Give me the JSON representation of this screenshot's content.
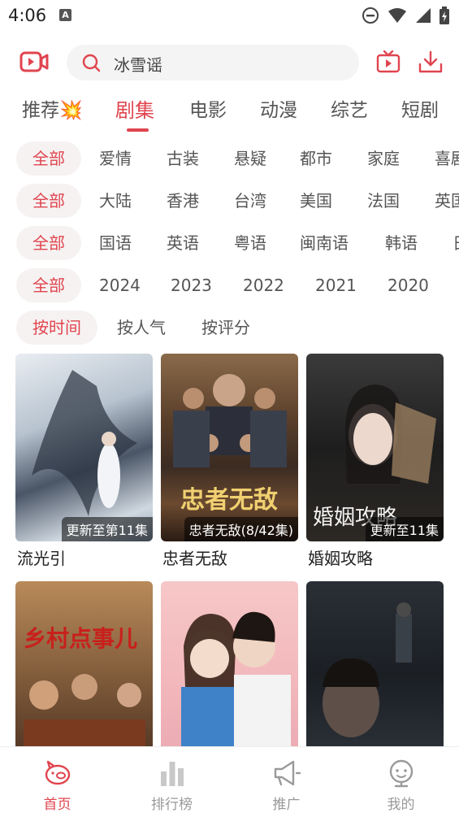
{
  "status_bar": {
    "time": "4:06",
    "a_icon_letter": "A"
  },
  "search": {
    "placeholder": "冰雪谣"
  },
  "tabs": [
    {
      "label": "推荐💥"
    },
    {
      "label": "剧集"
    },
    {
      "label": "电影"
    },
    {
      "label": "动漫"
    },
    {
      "label": "综艺"
    },
    {
      "label": "短剧"
    }
  ],
  "filters": {
    "genre": [
      "全部",
      "爱情",
      "古装",
      "悬疑",
      "都市",
      "家庭",
      "喜剧"
    ],
    "region": [
      "全部",
      "大陆",
      "香港",
      "台湾",
      "美国",
      "法国",
      "英国"
    ],
    "language": [
      "全部",
      "国语",
      "英语",
      "粤语",
      "闽南语",
      "韩语",
      "日语"
    ],
    "year": [
      "全部",
      "2024",
      "2023",
      "2022",
      "2021",
      "2020"
    ],
    "sort": [
      "按时间",
      "按人气",
      "按评分"
    ]
  },
  "cards": [
    {
      "title": "流光引",
      "badge": "更新至第11集"
    },
    {
      "title": "忠者无敌",
      "badge": "忠者无敌(8/42集)"
    },
    {
      "title": "婚姻攻略",
      "badge": "更新至11集"
    },
    {
      "title": "",
      "badge": ""
    },
    {
      "title": "",
      "badge": ""
    },
    {
      "title": "",
      "badge": ""
    }
  ],
  "bottom_nav": [
    {
      "label": "首页",
      "icon": "pig-icon"
    },
    {
      "label": "排行榜",
      "icon": "bar-chart-icon"
    },
    {
      "label": "推广",
      "icon": "megaphone-icon"
    },
    {
      "label": "我的",
      "icon": "face-icon"
    }
  ],
  "colors": {
    "accent": "#e0454f",
    "chip_bg": "#f6f2f2",
    "inactive": "#999999"
  }
}
